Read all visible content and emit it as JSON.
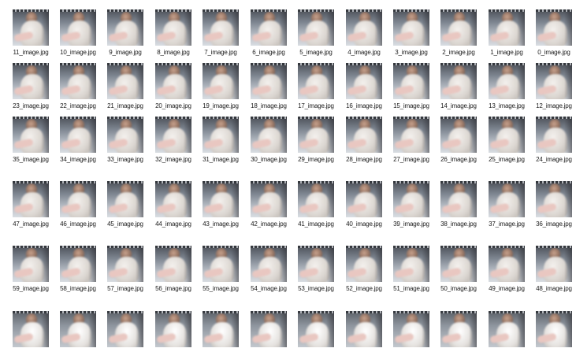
{
  "view": {
    "rows": [
      [
        "11_image.jpg",
        "10_image.jpg",
        "9_image.jpg",
        "8_image.jpg",
        "7_image.jpg",
        "6_image.jpg",
        "5_image.jpg",
        "4_image.jpg",
        "3_image.jpg",
        "2_image.jpg",
        "1_image.jpg",
        "0_image.jpg"
      ],
      [
        "23_image.jpg",
        "22_image.jpg",
        "21_image.jpg",
        "20_image.jpg",
        "19_image.jpg",
        "18_image.jpg",
        "17_image.jpg",
        "16_image.jpg",
        "15_image.jpg",
        "14_image.jpg",
        "13_image.jpg",
        "12_image.jpg"
      ],
      [
        "35_image.jpg",
        "34_image.jpg",
        "33_image.jpg",
        "32_image.jpg",
        "31_image.jpg",
        "30_image.jpg",
        "29_image.jpg",
        "28_image.jpg",
        "27_image.jpg",
        "26_image.jpg",
        "25_image.jpg",
        "24_image.jpg"
      ],
      [
        "47_image.jpg",
        "46_image.jpg",
        "45_image.jpg",
        "44_image.jpg",
        "43_image.jpg",
        "42_image.jpg",
        "41_image.jpg",
        "40_image.jpg",
        "39_image.jpg",
        "38_image.jpg",
        "37_image.jpg",
        "36_image.jpg"
      ],
      [
        "59_image.jpg",
        "58_image.jpg",
        "57_image.jpg",
        "56_image.jpg",
        "55_image.jpg",
        "54_image.jpg",
        "53_image.jpg",
        "52_image.jpg",
        "51_image.jpg",
        "50_image.jpg",
        "49_image.jpg",
        "48_image.jpg"
      ],
      [
        "",
        "",
        "",
        "",
        "",
        "",
        "",
        "",
        "",
        "",
        "",
        ""
      ]
    ]
  }
}
